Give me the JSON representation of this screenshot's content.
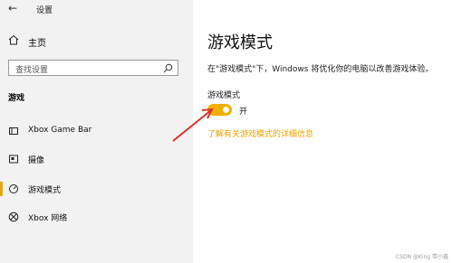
{
  "window": {
    "title": "设置"
  },
  "sidebar": {
    "home_label": "主页",
    "search_placeholder": "查找设置",
    "section_title": "游戏",
    "items": [
      {
        "label": "Xbox Game Bar",
        "icon": "gamebar-icon"
      },
      {
        "label": "摄像",
        "icon": "capture-icon"
      },
      {
        "label": "游戏模式",
        "icon": "gamemode-icon",
        "active": true
      },
      {
        "label": "Xbox 网络",
        "icon": "xbox-icon"
      }
    ]
  },
  "main": {
    "title": "游戏模式",
    "description": "在\"游戏模式\"下，Windows 将优化你的电脑以改善游戏体验。",
    "setting_label": "游戏模式",
    "toggle_state": "开",
    "toggle_on": true,
    "link_text": "了解有关游戏模式的详细信息"
  },
  "watermark": "CSDN @King 带小鑫",
  "colors": {
    "accent": "#f0b000",
    "link": "#e8a400",
    "annotation": "#e03030"
  }
}
